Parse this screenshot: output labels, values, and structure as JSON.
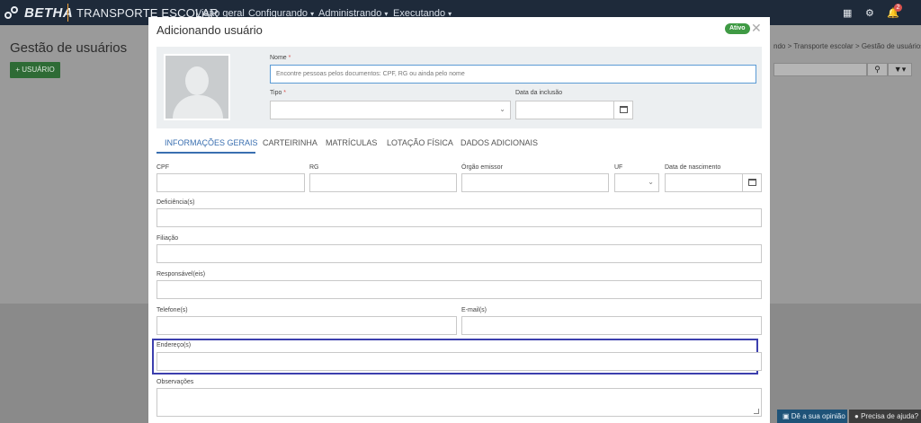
{
  "topbar": {
    "brand": "BETHA",
    "app_name": "TRANSPORTE ESCOLAR",
    "nav": [
      {
        "label": "Visão geral",
        "has_menu": false
      },
      {
        "label": "Configurando",
        "has_menu": true
      },
      {
        "label": "Administrando",
        "has_menu": true
      },
      {
        "label": "Executando",
        "has_menu": true
      }
    ],
    "notification_count": "2",
    "icons": [
      "apps-grid-icon",
      "settings-icon",
      "bell-icon"
    ]
  },
  "background_page": {
    "title": "Gestão de usuários",
    "add_button": "+ USUÁRIO",
    "breadcrumb": "ndo > Transporte escolar > Gestão de usuários",
    "search_icon": "search-icon",
    "filter_icon": "filter-icon",
    "footer_feedback": "Dê a sua opinião",
    "footer_help": "Precisa de ajuda?"
  },
  "modal": {
    "title": "Adicionando usuário",
    "status": "Ativo",
    "close_icon": "close-icon",
    "header": {
      "nome_label": "Nome",
      "nome_placeholder": "Encontre pessoas pelos documentos: CPF, RG ou ainda pelo nome",
      "tipo_label": "Tipo",
      "tipo_value": "",
      "data_inclusao_label": "Data da inclusão",
      "data_inclusao_value": ""
    },
    "tabs": [
      "INFORMAÇÕES GERAIS",
      "CARTEIRINHA",
      "MATRÍCULAS",
      "LOTAÇÃO FÍSICA",
      "DADOS ADICIONAIS"
    ],
    "active_tab": "INFORMAÇÕES GERAIS",
    "form": {
      "cpf_label": "CPF",
      "rg_label": "RG",
      "orgao_label": "Órgão emissor",
      "uf_label": "UF",
      "nascimento_label": "Data de nascimento",
      "deficiencia_label": "Deficiência(s)",
      "filiacao_label": "Filiação",
      "responsavel_label": "Responsável(eis)",
      "telefone_label": "Telefone(s)",
      "email_label": "E-mail(s)",
      "endereco_label": "Endereço(s)",
      "observacoes_label": "Observações"
    }
  },
  "colors": {
    "topbar_bg": "#1e2a3a",
    "accent_blue": "#3a6fb0",
    "status_green": "#3f9a44",
    "highlight": "#3c3fae",
    "brand_orange": "#f2a33a"
  }
}
